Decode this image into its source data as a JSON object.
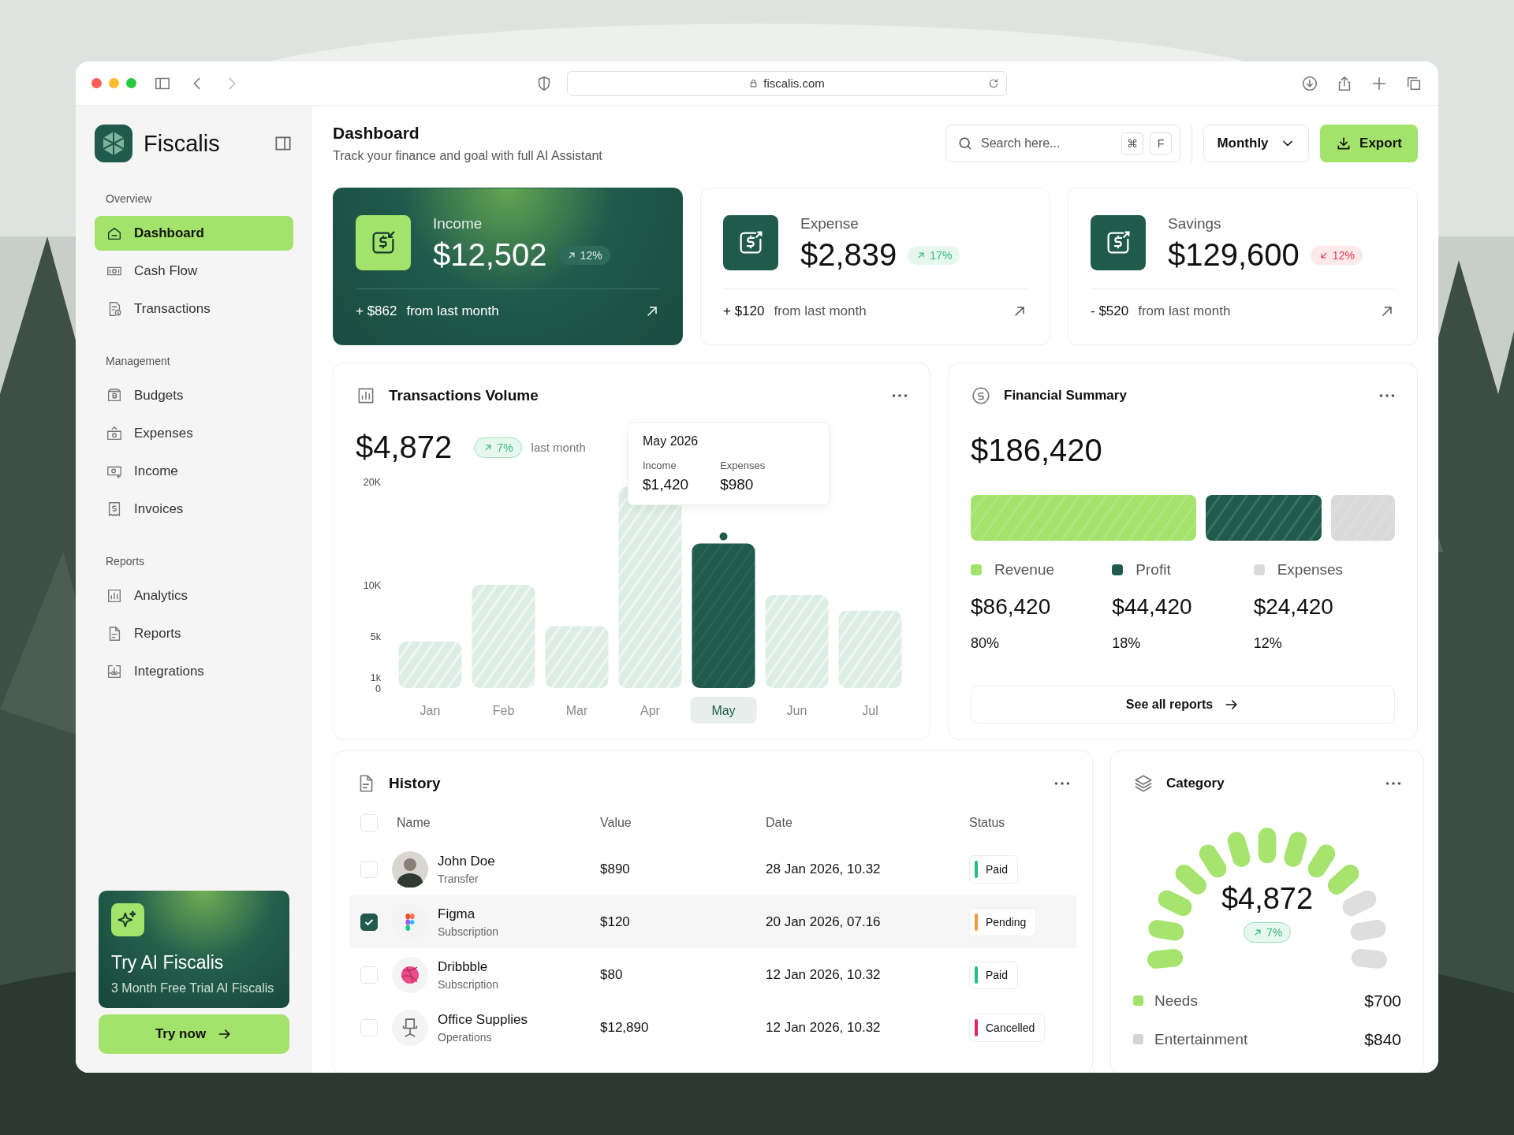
{
  "browser": {
    "url": "fiscalis.com"
  },
  "sidebar": {
    "app_name": "Fiscalis",
    "sections": [
      {
        "title": "Overview",
        "items": [
          {
            "label": "Dashboard",
            "selected": true
          },
          {
            "label": "Cash Flow",
            "selected": false
          },
          {
            "label": "Transactions",
            "selected": false
          }
        ]
      },
      {
        "title": "Management",
        "items": [
          {
            "label": "Budgets",
            "selected": false
          },
          {
            "label": "Expenses",
            "selected": false
          },
          {
            "label": "Income",
            "selected": false
          },
          {
            "label": "Invoices",
            "selected": false
          }
        ]
      },
      {
        "title": "Reports",
        "items": [
          {
            "label": "Analytics",
            "selected": false
          },
          {
            "label": "Reports",
            "selected": false
          },
          {
            "label": "Integrations",
            "selected": false
          }
        ]
      }
    ],
    "promo": {
      "title": "Try AI Fiscalis",
      "subtitle": "3 Month Free Trial AI Fiscalis",
      "button": "Try now"
    }
  },
  "header": {
    "title": "Dashboard",
    "subtitle": "Track your finance and goal with full AI Assistant",
    "search": {
      "placeholder": "Search here...",
      "shortcut_keys": [
        "⌘",
        "F"
      ]
    },
    "period": "Monthly",
    "export_button": "Export"
  },
  "stat_cards": [
    {
      "label": "Income",
      "value": "$12,502",
      "change": "12%",
      "falling": false,
      "highlighted": true,
      "delta": "+ $862",
      "delta_note": "from last month"
    },
    {
      "label": "Expense",
      "value": "$2,839",
      "change": "17%",
      "falling": false,
      "highlighted": false,
      "delta": "+ $120",
      "delta_note": "from last month"
    },
    {
      "label": "Savings",
      "value": "$129,600",
      "change": "12%",
      "falling": true,
      "highlighted": false,
      "delta": "- $520",
      "delta_note": "from last month"
    }
  ],
  "transactions_volume": {
    "title": "Transactions Volume",
    "total": "$4,872",
    "change": "7%",
    "change_note": "last month",
    "tooltip": {
      "title": "May 2026",
      "items": [
        {
          "label": "Income",
          "value": "$1,420"
        },
        {
          "label": "Expenses",
          "value": "$980"
        }
      ]
    },
    "bars": [
      {
        "selected": false
      },
      {
        "selected": false
      },
      {
        "selected": false
      },
      {
        "selected": false
      },
      {
        "selected": true
      },
      {
        "selected": false
      },
      {
        "selected": false
      }
    ],
    "chart_data": {
      "type": "bar",
      "categories": [
        "Jan",
        "Feb",
        "Mar",
        "Apr",
        "May",
        "Jun",
        "Jul"
      ],
      "values": [
        4500,
        10000,
        6000,
        19500,
        14000,
        9000,
        7500
      ],
      "ylim": [
        0,
        20000
      ],
      "yticks": [
        {
          "value": 0,
          "label": "0"
        },
        {
          "value": 1000,
          "label": "1k"
        },
        {
          "value": 5000,
          "label": "5k"
        },
        {
          "value": 10000,
          "label": "10K"
        },
        {
          "value": 20000,
          "label": "20K"
        }
      ]
    }
  },
  "financial_summary": {
    "title": "Financial Summary",
    "total": "$186,420",
    "button": "See all reports",
    "items": [
      {
        "label": "Revenue",
        "amount": "$86,420",
        "percent": "80%",
        "color": "#a3e36b"
      },
      {
        "label": "Profit",
        "amount": "$44,420",
        "percent": "18%",
        "color": "#1f5a4c"
      },
      {
        "label": "Expenses",
        "amount": "$24,420",
        "percent": "12%",
        "color": "#dadada"
      }
    ]
  },
  "history": {
    "title": "History",
    "columns": [
      "Name",
      "Value",
      "Date",
      "Status"
    ],
    "all_checked": false,
    "rows": [
      {
        "name": "John Doe",
        "type": "Transfer",
        "value": "$890",
        "date": "28 Jan 2026, 10.32",
        "status": "Paid",
        "color": "#22c07a",
        "checked": false
      },
      {
        "name": "Figma",
        "type": "Subscription",
        "kind": "squares",
        "value": "$120",
        "date": "20 Jan 2026, 07.16",
        "status": "Pending",
        "color": "#f59a3c",
        "checked": true
      },
      {
        "name": "Dribbble",
        "type": "Subscription",
        "kind": "ball",
        "value": "$80",
        "date": "12 Jan 2026, 10.32",
        "status": "Paid",
        "color": "#22c07a",
        "checked": false
      },
      {
        "name": "Office Supplies",
        "type": "Operations",
        "kind": "chair",
        "value": "$12,890",
        "date": "12 Jan 2026, 10.32",
        "status": "Cancelled",
        "color": "#e0245e",
        "checked": false
      }
    ]
  },
  "category": {
    "title": "Category",
    "total": "$4,872",
    "change": "7%",
    "level": 0.77,
    "items": [
      {
        "label": "Needs",
        "amount": "$700",
        "color": "#a3e36b"
      },
      {
        "label": "Entertainment",
        "amount": "$840",
        "color": "#d4d4d4"
      }
    ]
  }
}
